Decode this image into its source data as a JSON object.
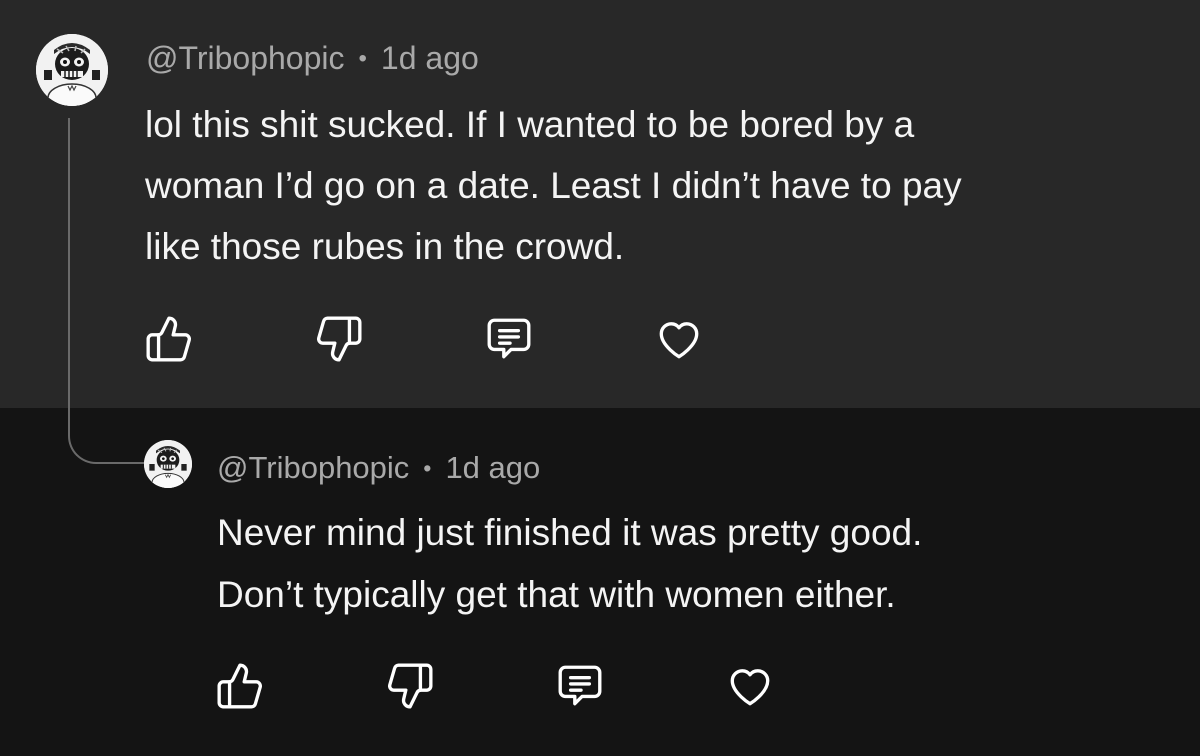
{
  "comment": {
    "author": "@Tribophopic",
    "separator": "•",
    "timestamp": "1d ago",
    "text": "lol this shit sucked. If I wanted to be bored by a\nwoman I’d go on a date. Least I didn’t have to pay\nlike those rubes in the crowd.",
    "avatar_icon": "skull-avatar-icon"
  },
  "reply": {
    "author": "@Tribophopic",
    "separator": "•",
    "timestamp": "1d ago",
    "text": "Never mind just finished it was pretty good.\nDon’t typically get that with women either.",
    "avatar_icon": "skull-avatar-icon"
  },
  "actions": [
    "thumbs-up-icon",
    "thumbs-down-icon",
    "reply-icon",
    "heart-icon"
  ],
  "colors": {
    "top_background": "#282828",
    "reply_background": "#141414",
    "meta_text": "#a9a9a9",
    "body_text": "#f4f4f4",
    "thread_line": "#6a6a6a"
  }
}
